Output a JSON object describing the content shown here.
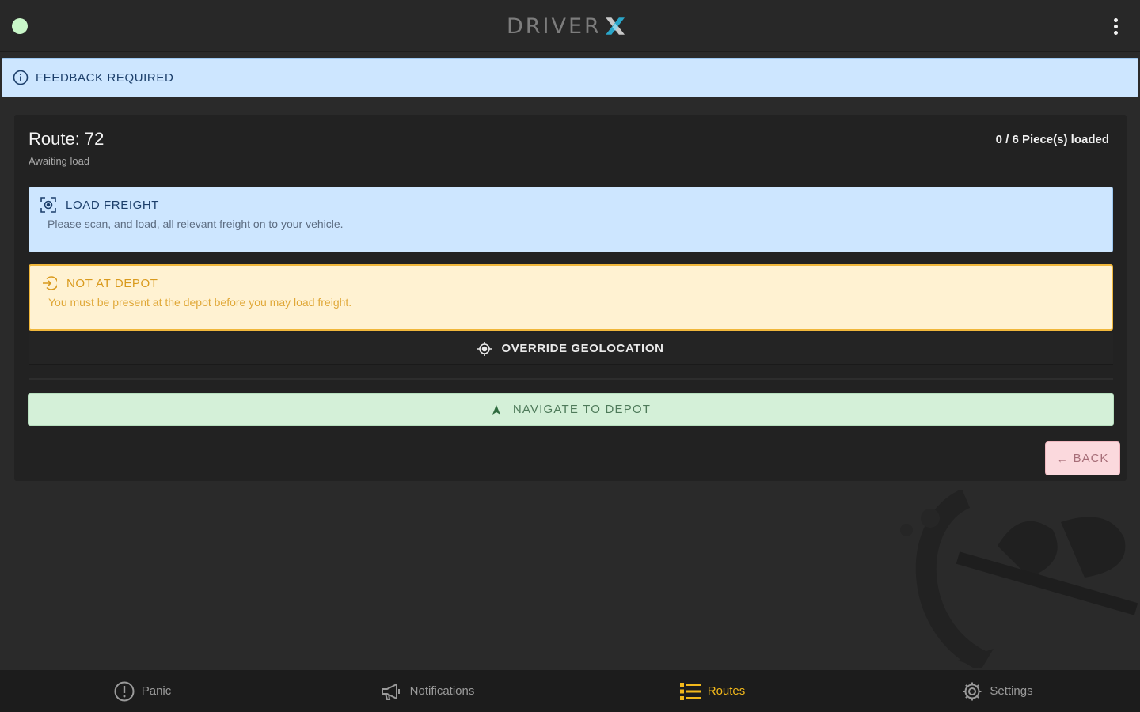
{
  "app": {
    "logo_text": "DRIVER",
    "logo_mark": "X",
    "status_color": "#c9f7c9",
    "accent_color": "#f2b81b"
  },
  "feedback": {
    "label": "FEEDBACK REQUIRED",
    "icon": "info-circle-icon"
  },
  "route": {
    "title": "Route: 72",
    "subtitle": "Awaiting load",
    "pieces": "0 / 6 Piece(s) loaded"
  },
  "alerts": {
    "load": {
      "title": "LOAD FREIGHT",
      "body": "Please scan, and load, all relevant freight on to your vehicle.",
      "icon": "scan-icon"
    },
    "depot": {
      "title": "NOT AT DEPOT",
      "body": "You must be present at the depot before you may load freight.",
      "icon": "enter-icon"
    }
  },
  "actions": {
    "override": "OVERRIDE GEOLOCATION",
    "navigate": "NAVIGATE TO DEPOT",
    "back": "BACK"
  },
  "nav": {
    "items": [
      {
        "label": "Panic",
        "icon": "panic-icon",
        "active": false
      },
      {
        "label": "Notifications",
        "icon": "megaphone-icon",
        "active": false
      },
      {
        "label": "Routes",
        "icon": "list-icon",
        "active": true
      },
      {
        "label": "Settings",
        "icon": "gear-icon",
        "active": false
      }
    ]
  }
}
